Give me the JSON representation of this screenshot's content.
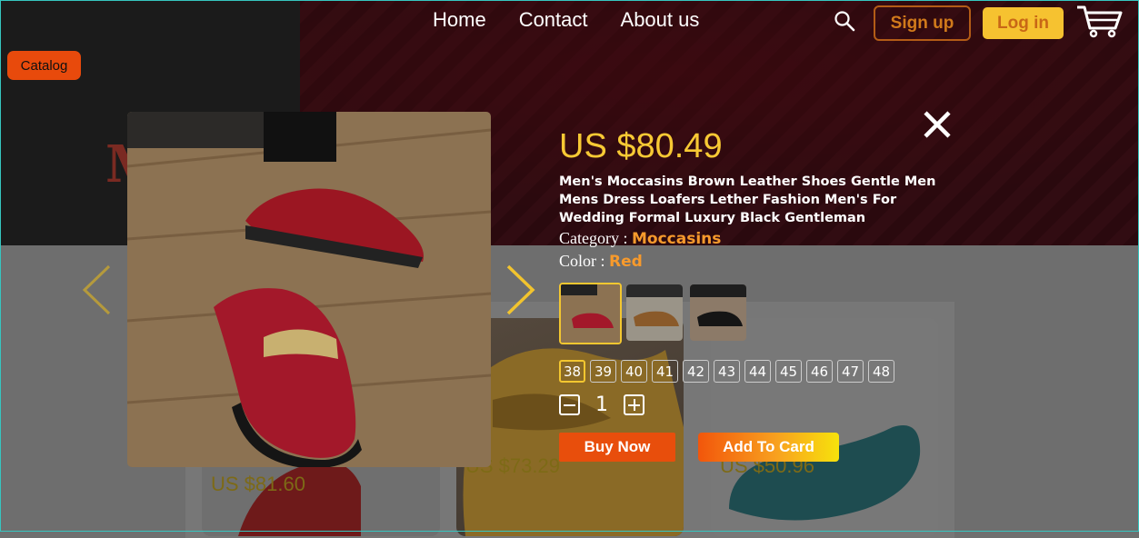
{
  "nav": {
    "links": [
      "Home",
      "Contact",
      "About us"
    ]
  },
  "header": {
    "signup_label": "Sign up",
    "login_label": "Log in",
    "icons": [
      "search-icon",
      "cart-icon"
    ]
  },
  "catalog_label": "Catalog",
  "hero": {
    "partial_heading": "M"
  },
  "background_products": [
    {
      "price": "US $81.60"
    },
    {
      "price": "US $73.29"
    },
    {
      "price": "US $50.96"
    }
  ],
  "modal": {
    "price": "US $80.49",
    "title": "Men's Moccasins Brown Leather Shoes Gentle Men Mens Dress Loafers Lether Fashion Men's For Wedding Formal Luxury Black Gentleman",
    "category_label": "Category :",
    "category_value": "Moccasins",
    "color_label": "Color :",
    "color_value": "Red",
    "variants": [
      "red",
      "brown",
      "black"
    ],
    "selected_variant": 0,
    "sizes": [
      "38",
      "39",
      "40",
      "41",
      "42",
      "43",
      "44",
      "45",
      "46",
      "47",
      "48"
    ],
    "selected_size": "38",
    "quantity": "1",
    "buy_label": "Buy Now",
    "add_label": "Add To Card"
  },
  "colors": {
    "accent": "#f7c934",
    "orange": "#e84e0c",
    "highlight": "#f79a2c"
  }
}
